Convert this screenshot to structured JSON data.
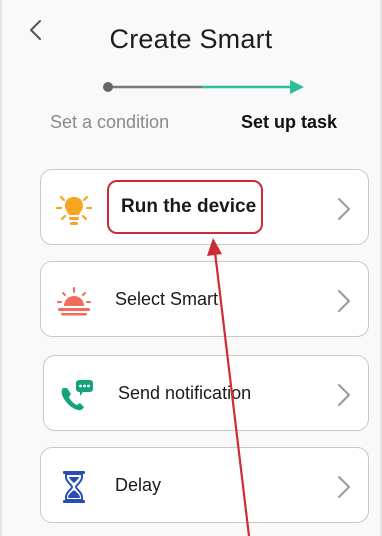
{
  "header": {
    "title": "Create Smart"
  },
  "steps": [
    {
      "label": "Set a condition",
      "state": "done"
    },
    {
      "label": "Set up task",
      "state": "active"
    }
  ],
  "tasks": [
    {
      "label": "Run the device",
      "icon": "lightbulb-icon"
    },
    {
      "label": "Select Smart",
      "icon": "sunrise-icon"
    },
    {
      "label": "Send notification",
      "icon": "phone-message-icon"
    },
    {
      "label": "Delay",
      "icon": "hourglass-icon"
    }
  ],
  "colors": {
    "accent_teal": "#2bbf9a",
    "stepper_gray": "#7a7a7a",
    "bulb_orange": "#f5a623",
    "sunrise_red": "#f26b5b",
    "phone_green": "#16a37c",
    "hourglass_blue": "#2a4db5",
    "annotation_red": "#cf2b35"
  }
}
